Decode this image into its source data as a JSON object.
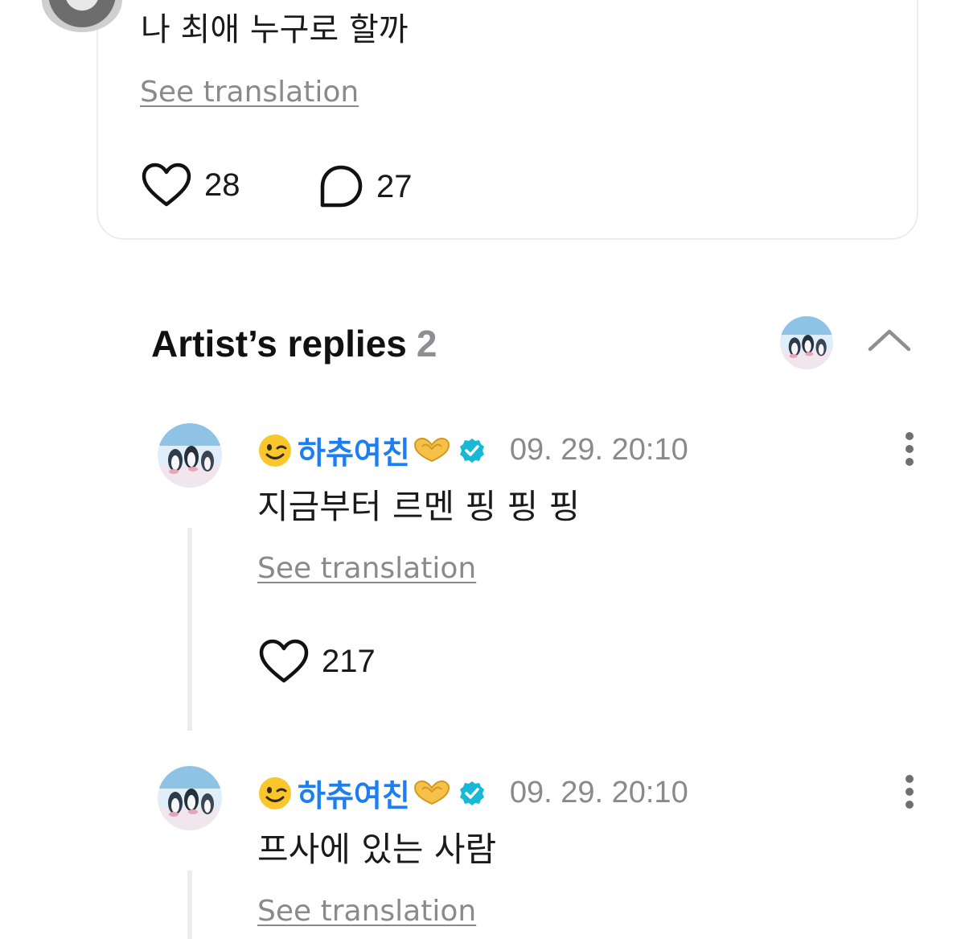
{
  "post": {
    "text": "나 최애 누구로 할까",
    "see_translation": "See translation",
    "like_count": "28",
    "comment_count": "27"
  },
  "artist_replies": {
    "title": "Artist’s replies",
    "count": "2"
  },
  "replies": [
    {
      "author": "하츄여친",
      "author_emoji": "winking-face",
      "author_suffix_emoji": "heart-hands",
      "verified": true,
      "timestamp": "09. 29. 20:10",
      "text": "지금부터 르멘 핑 핑 핑",
      "see_translation": "See translation",
      "like_count": "217"
    },
    {
      "author": "하츄여친",
      "author_emoji": "winking-face",
      "author_suffix_emoji": "heart-hands",
      "verified": true,
      "timestamp": "09. 29. 20:10",
      "text": "프사에 있는 사람",
      "see_translation": "See translation"
    }
  ],
  "colors": {
    "author_name": "#1d7ef2",
    "verified_badge": "#17b9d6",
    "secondary_text": "#8a8a8a",
    "card_border": "#ececef"
  }
}
